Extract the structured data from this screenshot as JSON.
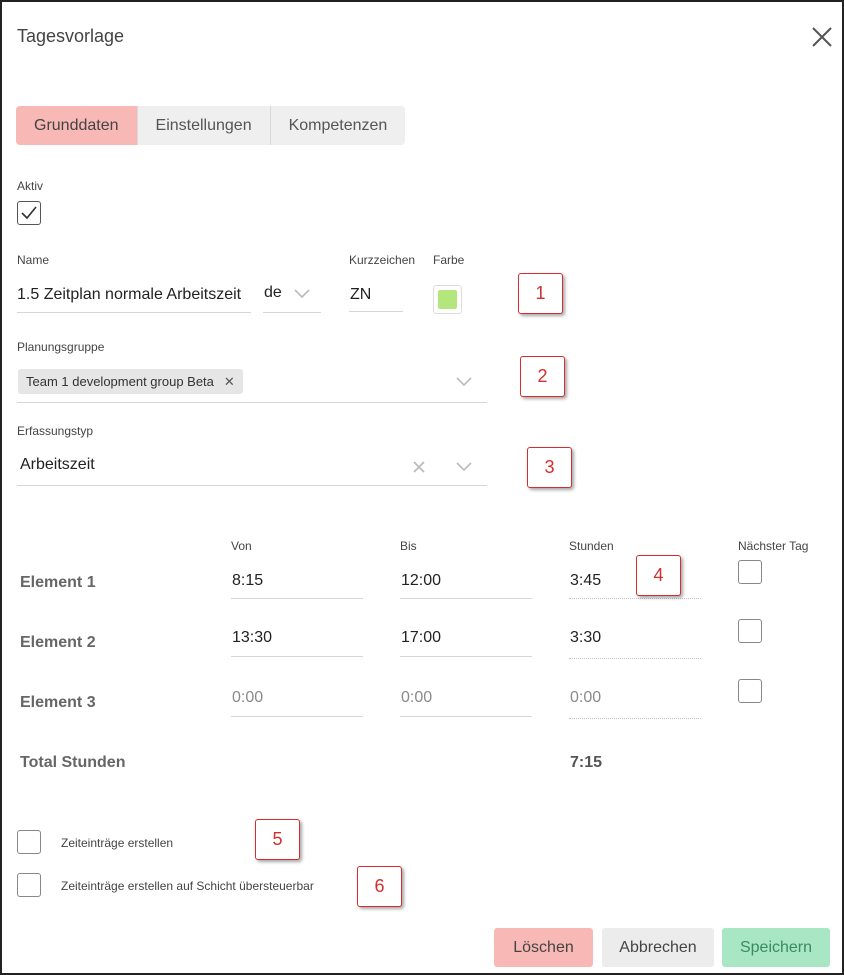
{
  "dialog": {
    "title": "Tagesvorlage"
  },
  "tabs": [
    {
      "label": "Grunddaten",
      "active": true
    },
    {
      "label": "Einstellungen",
      "active": false
    },
    {
      "label": "Kompetenzen",
      "active": false
    }
  ],
  "aktiv": {
    "label": "Aktiv",
    "checked": true
  },
  "name": {
    "label": "Name",
    "value": "1.5 Zeitplan normale Arbeitszeit"
  },
  "language": {
    "value": "de"
  },
  "kurzzeichen": {
    "label": "Kurzzeichen",
    "value": "ZN"
  },
  "farbe": {
    "label": "Farbe",
    "color": "#b4e67e"
  },
  "planungsgruppe": {
    "label": "Planungsgruppe",
    "chips": [
      "Team 1 development group Beta"
    ]
  },
  "erfassungstyp": {
    "label": "Erfassungstyp",
    "value": "Arbeitszeit"
  },
  "elements": {
    "headers": {
      "von": "Von",
      "bis": "Bis",
      "stunden": "Stunden",
      "naechster_tag": "Nächster Tag"
    },
    "rows": [
      {
        "label": "Element 1",
        "von": "8:15",
        "bis": "12:00",
        "stunden": "3:45",
        "naechster_tag": false
      },
      {
        "label": "Element 2",
        "von": "13:30",
        "bis": "17:00",
        "stunden": "3:30",
        "naechster_tag": false
      },
      {
        "label": "Element 3",
        "von": "0:00",
        "bis": "0:00",
        "stunden": "0:00",
        "naechster_tag": false
      }
    ],
    "total": {
      "label": "Total Stunden",
      "value": "7:15"
    }
  },
  "options": [
    {
      "label": "Zeiteinträge erstellen",
      "checked": false
    },
    {
      "label": "Zeiteinträge erstellen auf Schicht übersteuerbar",
      "checked": false
    }
  ],
  "buttons": {
    "delete": {
      "label": "Löschen",
      "color": "#f8b9b6"
    },
    "cancel": {
      "label": "Abbrechen",
      "color": "#ececec"
    },
    "save": {
      "label": "Speichern",
      "color": "#a8e6c4"
    }
  },
  "callouts": [
    "1",
    "2",
    "3",
    "4",
    "5",
    "6"
  ]
}
